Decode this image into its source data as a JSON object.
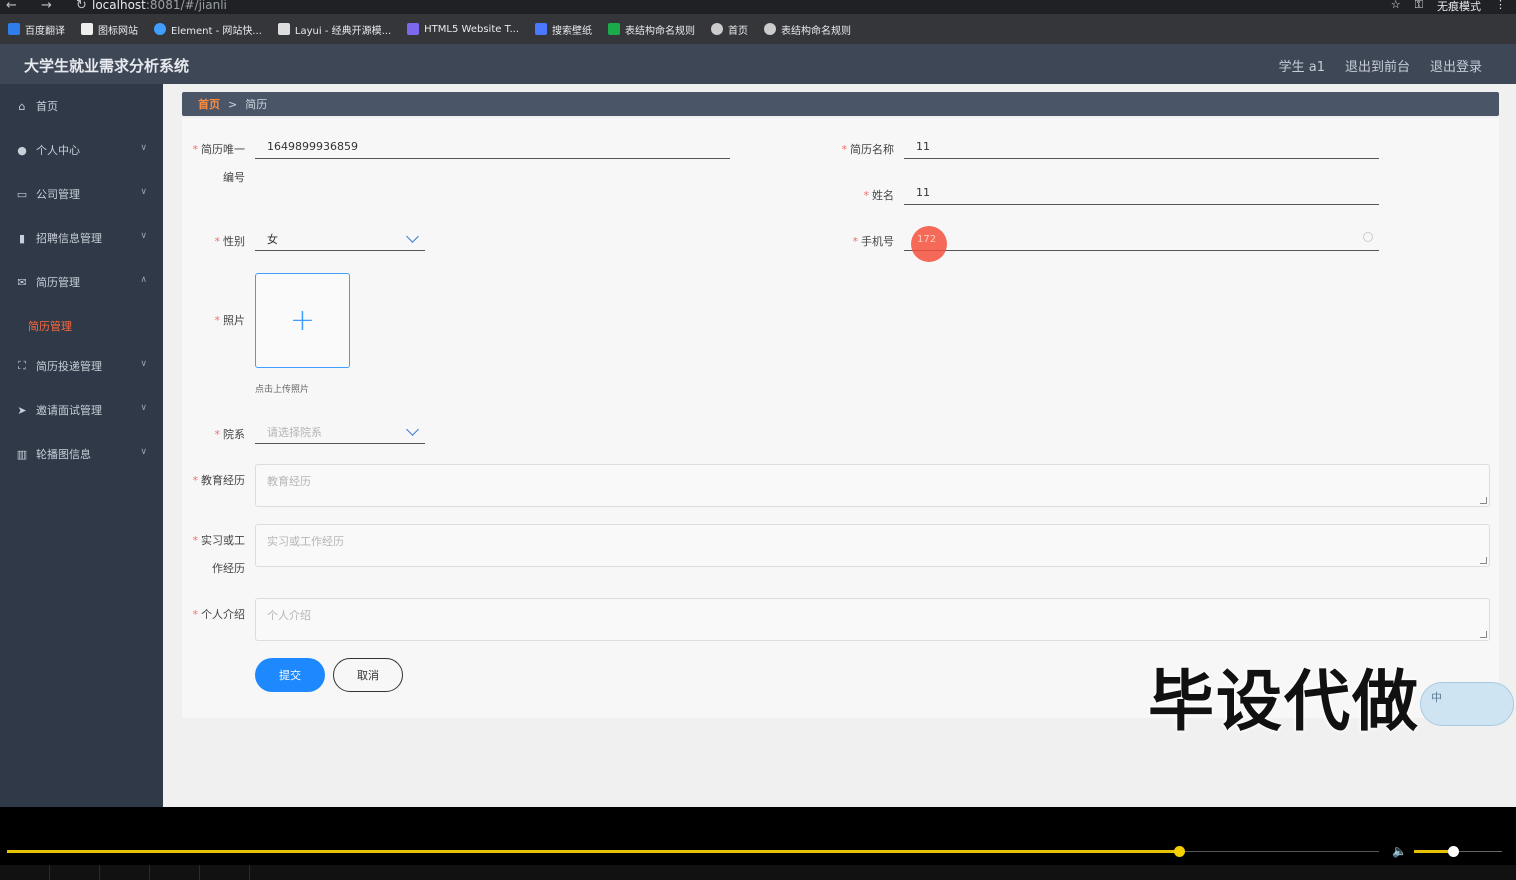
{
  "browser": {
    "url_host": "localhost",
    "url_path": ":8081/#/jianli",
    "mode_label": "无痕模式",
    "bookmarks": [
      "百度翻译",
      "图标网站",
      "Element - 网站快...",
      "Layui - 经典开源模...",
      "HTML5 Website T...",
      "搜索壁纸",
      "表结构命名规则",
      "首页",
      "表结构命名规则"
    ]
  },
  "header": {
    "title": "大学生就业需求分析系统",
    "user": "学生 a1",
    "to_front": "退出到前台",
    "logout": "退出登录"
  },
  "sidebar": {
    "items": [
      {
        "label": "首页",
        "icon": "home-icon"
      },
      {
        "label": "个人中心",
        "icon": "user-icon"
      },
      {
        "label": "公司管理",
        "icon": "company-icon"
      },
      {
        "label": "招聘信息管理",
        "icon": "recruit-icon"
      },
      {
        "label": "简历管理",
        "icon": "mail-icon"
      },
      {
        "label": "简历投递管理",
        "icon": "frame-icon"
      },
      {
        "label": "邀请面试管理",
        "icon": "send-icon"
      },
      {
        "label": "轮播图信息",
        "icon": "chart-icon"
      }
    ],
    "active_sub": "简历管理"
  },
  "breadcrumb": {
    "home": "首页",
    "separator": ">",
    "current": "简历"
  },
  "form": {
    "resume_id_label_1": "简历唯一",
    "resume_id_label_2": "编号",
    "resume_id_value": "1649899936859",
    "resume_name_label": "简历名称",
    "resume_name_value": "11",
    "name_label": "姓名",
    "name_value": "11",
    "gender_label": "性别",
    "gender_value": "女",
    "phone_label": "手机号",
    "phone_value": "172",
    "photo_label": "照片",
    "photo_plus": "+",
    "photo_hint": "点击上传照片",
    "dept_label": "院系",
    "dept_placeholder": "请选择院系",
    "edu_label": "教育经历",
    "edu_placeholder": "教育经历",
    "work_label_1": "实习或工",
    "work_label_2": "作经历",
    "work_placeholder": "实习或工作经历",
    "intro_label": "个人介绍",
    "intro_placeholder": "个人介绍",
    "submit": "提交",
    "cancel": "取消"
  },
  "overlay": {
    "watermark": "毕设代做",
    "widget_text": "中"
  },
  "player": {
    "progress": 0.775,
    "volume": 0.45
  }
}
